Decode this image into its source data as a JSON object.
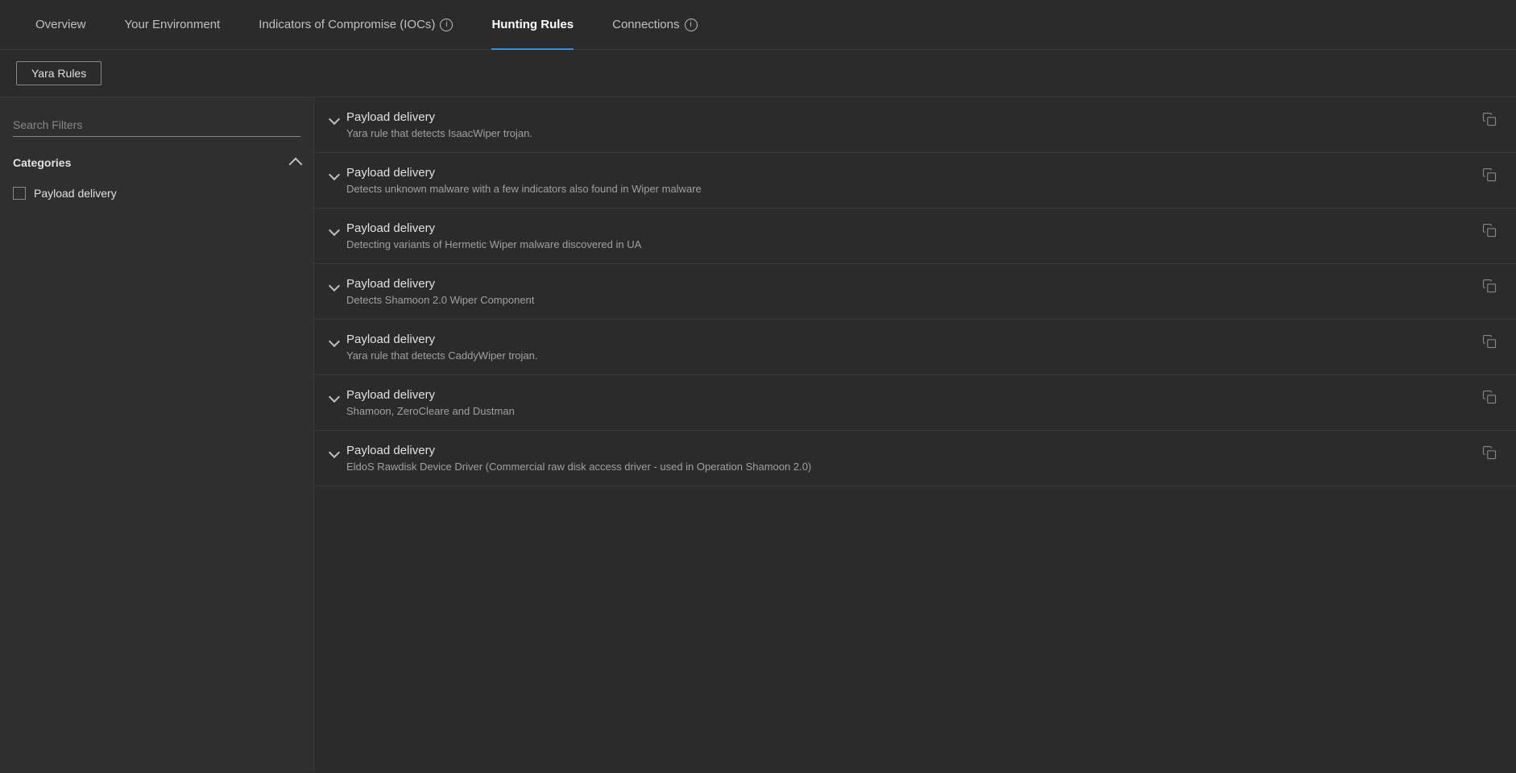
{
  "nav": {
    "tabs": [
      {
        "id": "overview",
        "label": "Overview",
        "active": false,
        "hasInfo": false
      },
      {
        "id": "your-environment",
        "label": "Your Environment",
        "active": false,
        "hasInfo": false
      },
      {
        "id": "iocs",
        "label": "Indicators of Compromise (IOCs)",
        "active": false,
        "hasInfo": true
      },
      {
        "id": "hunting-rules",
        "label": "Hunting Rules",
        "active": true,
        "hasInfo": false
      },
      {
        "id": "connections",
        "label": "Connections",
        "active": false,
        "hasInfo": true
      }
    ]
  },
  "subNav": {
    "yaraRulesLabel": "Yara Rules"
  },
  "sidebar": {
    "searchPlaceholder": "Search Filters",
    "categoriesLabel": "Categories",
    "categories": [
      {
        "id": "payload-delivery",
        "label": "Payload delivery",
        "checked": false
      }
    ]
  },
  "rules": [
    {
      "id": 1,
      "category": "Payload delivery",
      "description": "Yara rule that detects IsaacWiper trojan."
    },
    {
      "id": 2,
      "category": "Payload delivery",
      "description": "Detects unknown malware with a few indicators also found in Wiper malware"
    },
    {
      "id": 3,
      "category": "Payload delivery",
      "description": "Detecting variants of Hermetic Wiper malware discovered in UA"
    },
    {
      "id": 4,
      "category": "Payload delivery",
      "description": "Detects Shamoon 2.0 Wiper Component"
    },
    {
      "id": 5,
      "category": "Payload delivery",
      "description": "Yara rule that detects CaddyWiper trojan."
    },
    {
      "id": 6,
      "category": "Payload delivery",
      "description": "Shamoon, ZeroCleare and Dustman"
    },
    {
      "id": 7,
      "category": "Payload delivery",
      "description": "EldoS Rawdisk Device Driver (Commercial raw disk access driver - used in Operation Shamoon 2.0)"
    }
  ],
  "colors": {
    "activeTabUnderline": "#3b8fd4",
    "background": "#2b2b2b",
    "sidebar": "#2f2f2f"
  }
}
